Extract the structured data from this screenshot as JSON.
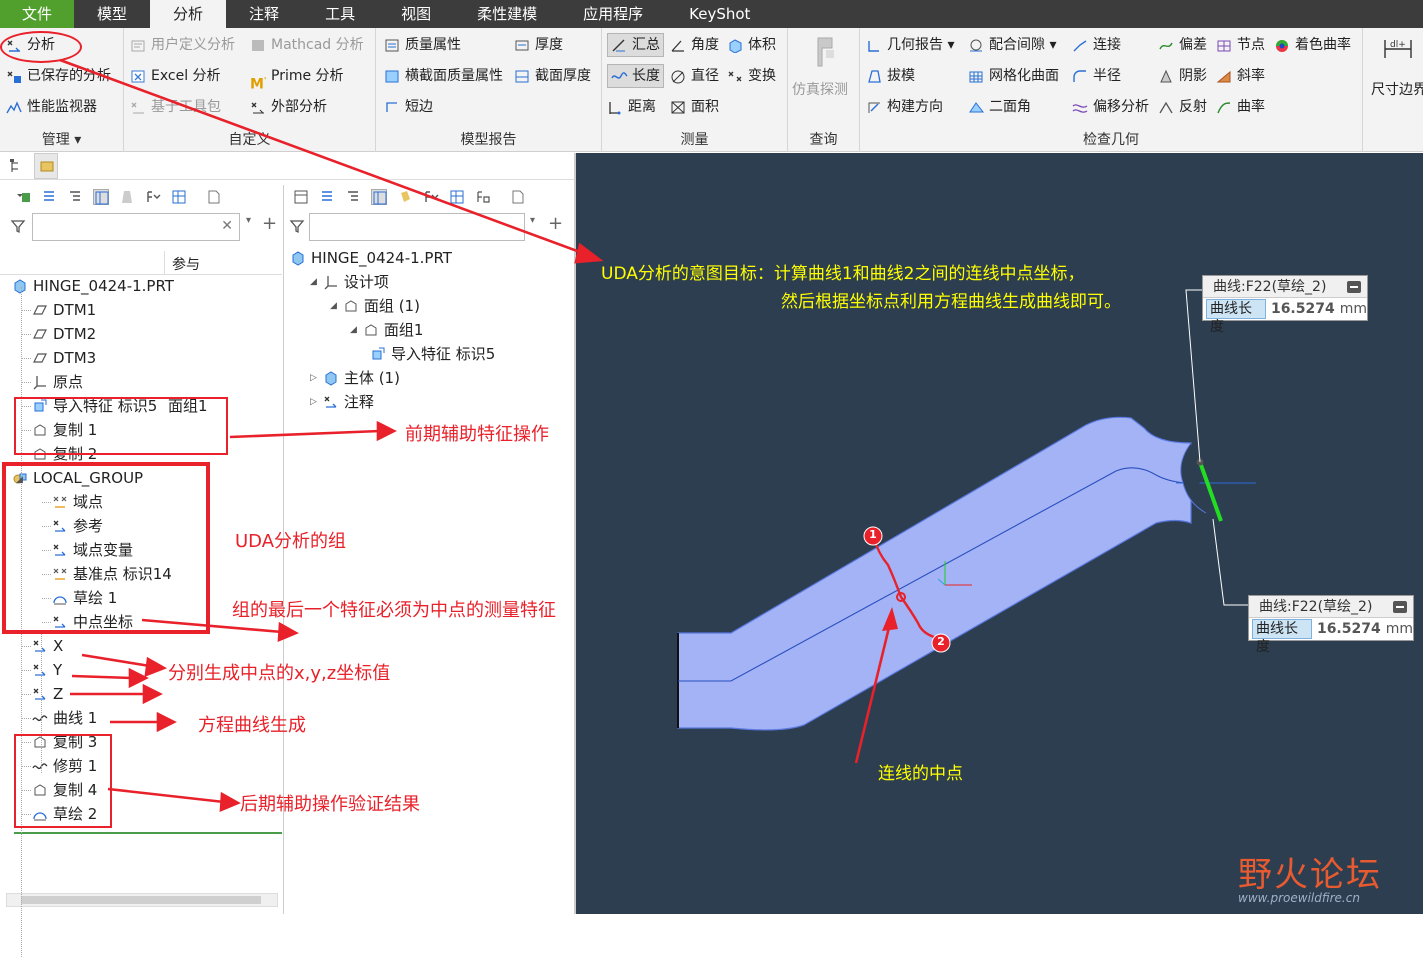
{
  "menubar": {
    "tabs": [
      "文件",
      "模型",
      "分析",
      "注释",
      "工具",
      "视图",
      "柔性建模",
      "应用程序",
      "KeyShot"
    ],
    "active": "分析"
  },
  "ribbon": {
    "manage": {
      "title": "管理",
      "items": [
        "分析",
        "已保存的分析",
        "性能监视器"
      ]
    },
    "custom": {
      "title": "自定义",
      "items": [
        "用户定义分析",
        "Mathcad 分析",
        "Excel 分析",
        "Prime 分析",
        "基于工具包",
        "外部分析"
      ]
    },
    "model_report": {
      "title": "模型报告",
      "items": [
        "质量属性",
        "厚度",
        "横截面质量属性",
        "截面厚度",
        "短边"
      ]
    },
    "measure": {
      "title": "测量",
      "items": [
        "汇总",
        "角度",
        "体积",
        "长度",
        "直径",
        "变换",
        "距离",
        "面积"
      ]
    },
    "query": {
      "title": "查询",
      "items": [
        "仿真探测"
      ]
    },
    "inspect": {
      "title": "检查几何",
      "items": [
        "几何报告",
        "配合间隙",
        "连接",
        "偏差",
        "节点",
        "着色曲率",
        "拔模",
        "网格化曲面",
        "半径",
        "阴影",
        "斜率",
        "构建方向",
        "二面角",
        "偏移分析",
        "反射",
        "曲率"
      ]
    },
    "dim": {
      "items": [
        "尺寸边界"
      ]
    }
  },
  "model_tree": {
    "column": "参与",
    "rows": [
      {
        "label": "HINGE_0424-1.PRT",
        "icon": "part-icon"
      },
      {
        "label": "DTM1",
        "icon": "plane-icon"
      },
      {
        "label": "DTM2",
        "icon": "plane-icon"
      },
      {
        "label": "DTM3",
        "icon": "plane-icon"
      },
      {
        "label": "原点",
        "icon": "csys-icon"
      },
      {
        "label": "导入特征 标识5",
        "icon": "import-icon",
        "extra": "面组1"
      },
      {
        "label": "复制 1",
        "icon": "copy-icon"
      },
      {
        "label": "复制 2",
        "icon": "copy-icon"
      },
      {
        "label": "LOCAL_GROUP",
        "icon": "group-icon"
      },
      {
        "label": "域点",
        "icon": "field-point-icon"
      },
      {
        "label": "参考",
        "icon": "analysis-icon"
      },
      {
        "label": "域点变量",
        "icon": "analysis-icon"
      },
      {
        "label": "基准点 标识14",
        "icon": "field-point-icon"
      },
      {
        "label": "草绘 1",
        "icon": "sketch-icon"
      },
      {
        "label": "中点坐标",
        "icon": "analysis-icon"
      },
      {
        "label": "X",
        "icon": "analysis-icon"
      },
      {
        "label": "Y",
        "icon": "analysis-icon"
      },
      {
        "label": "Z",
        "icon": "analysis-icon"
      },
      {
        "label": "曲线 1",
        "icon": "curve-icon"
      },
      {
        "label": "复制 3",
        "icon": "copy-icon"
      },
      {
        "label": "修剪 1",
        "icon": "curve-icon"
      },
      {
        "label": "复制 4",
        "icon": "copy-icon"
      },
      {
        "label": "草绘 2",
        "icon": "sketch-icon"
      }
    ]
  },
  "detail_tree": {
    "rows": [
      {
        "label": "HINGE_0424-1.PRT"
      },
      {
        "label": "设计项"
      },
      {
        "label": "面组 (1)"
      },
      {
        "label": "面组1"
      },
      {
        "label": "导入特征 标识5"
      },
      {
        "label": "主体 (1)"
      },
      {
        "label": "注释"
      }
    ]
  },
  "annotations": {
    "goal1": "UDA分析的意图目标：计算曲线1和曲线2之间的连线中点坐标，",
    "goal2": "然后根据坐标点利用方程曲线生成曲线即可。",
    "pre": "前期辅助特征操作",
    "uda_group": "UDA分析的组",
    "last_feature": "组的最后一个特征必须为中点的测量特征",
    "xyz": "分别生成中点的x,y,z坐标值",
    "equation": "方程曲线生成",
    "post": "后期辅助操作验证结果",
    "midpoint": "连线的中点",
    "p1": "1",
    "p2": "2"
  },
  "callouts": [
    {
      "title": "曲线:F22(草绘_2)",
      "label": "曲线长度",
      "value": "16.5274",
      "unit": "mm"
    },
    {
      "title": "曲线:F22(草绘_2)",
      "label": "曲线长度",
      "value": "16.5274",
      "unit": "mm"
    }
  ],
  "watermark": {
    "cn": "野火论坛",
    "url": "www.proewildfire.cn"
  },
  "colors": {
    "accent_red": "#e8212a",
    "file_green": "#51a02e",
    "viewport": "#2c3e50",
    "part_fill": "#a3b3f5",
    "note_yellow": "#ffff00"
  }
}
